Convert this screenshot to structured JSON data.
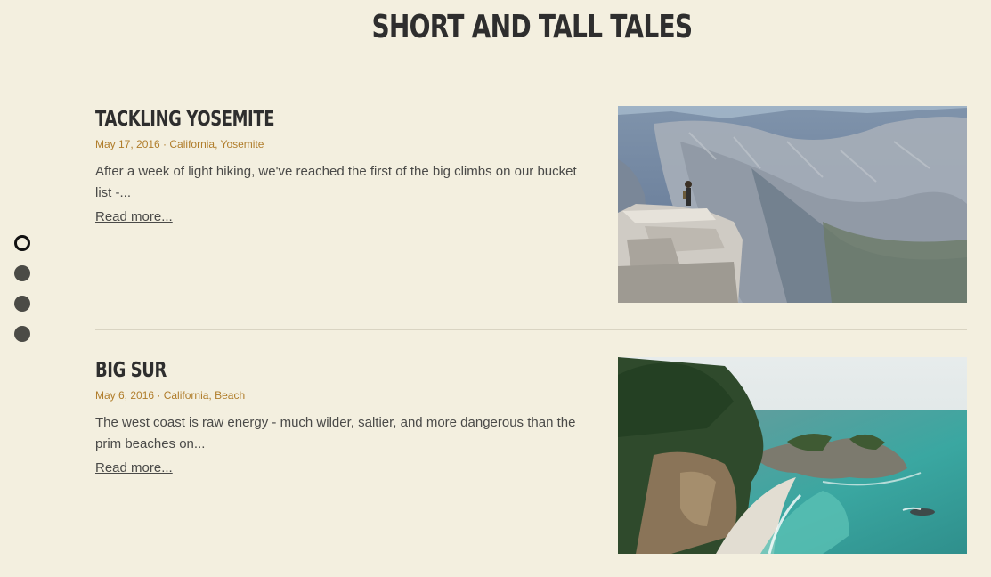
{
  "site": {
    "title": "SHORT AND TALL TALES"
  },
  "nav_dots": {
    "count": 4,
    "active_index": 0
  },
  "posts": [
    {
      "title": "TACKLING YOSEMITE",
      "date": "May 17, 2016",
      "separator": " · ",
      "tags": [
        "California",
        "Yosemite"
      ],
      "tag_joiner": ", ",
      "excerpt": "After a week of light hiking, we've reached the first of the big climbs on our bucket list -...",
      "read_more": "Read more...",
      "image_alt": "Hiker standing on a rock overhang above a granite valley"
    },
    {
      "title": "BIG SUR",
      "date": "May 6, 2016",
      "separator": " · ",
      "tags": [
        "California",
        "Beach"
      ],
      "tag_joiner": ", ",
      "excerpt": "The west coast is raw energy - much wilder, saltier, and more dangerous than the prim beaches on...",
      "read_more": "Read more...",
      "image_alt": "Rocky coastline with a sandy cove and turquoise sea"
    }
  ],
  "colors": {
    "background": "#f3efdf",
    "meta_accent": "#b07d2b",
    "text": "#4a4a48",
    "heading": "#2e2e2e",
    "dot": "#4b4b46"
  }
}
